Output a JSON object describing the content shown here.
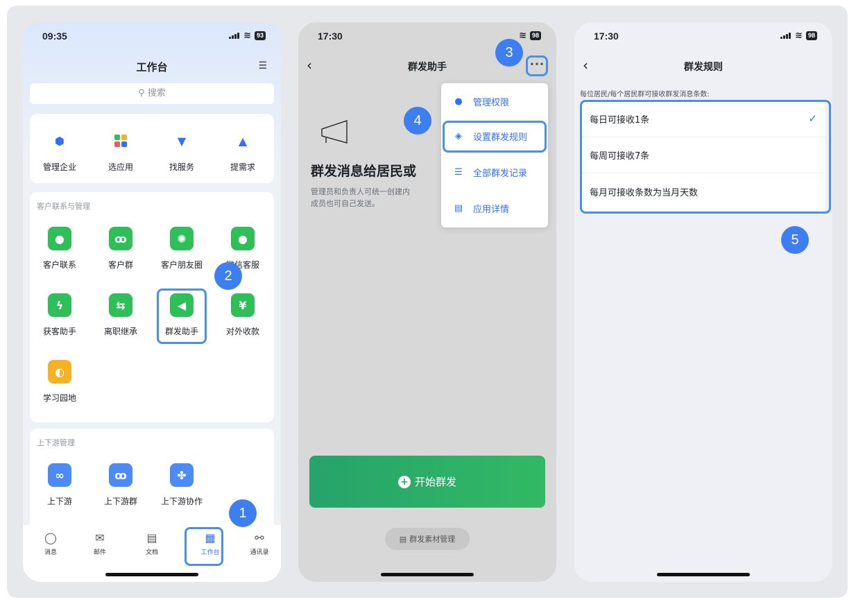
{
  "phone1": {
    "status": {
      "time": "09:35",
      "battery": "93"
    },
    "title": "工作台",
    "search_placeholder": "搜索",
    "top_tools": [
      {
        "label": "管理企业",
        "icon": "hexagon-icon"
      },
      {
        "label": "选应用",
        "icon": "apps-grid-icon"
      },
      {
        "label": "找服务",
        "icon": "tie-icon"
      },
      {
        "label": "提需求",
        "icon": "shapes-plus-icon"
      }
    ],
    "section_customer": {
      "title": "客户联系与管理",
      "items": [
        {
          "label": "客户联系",
          "icon": "chat-bubble-icon"
        },
        {
          "label": "客户群",
          "icon": "people-icon"
        },
        {
          "label": "客户朋友圈",
          "icon": "aperture-icon"
        },
        {
          "label": "微信客服",
          "icon": "message-icon"
        },
        {
          "label": "获客助手",
          "icon": "lightning-icon"
        },
        {
          "label": "离职继承",
          "icon": "transfer-icon"
        },
        {
          "label": "群发助手",
          "icon": "megaphone-icon"
        },
        {
          "label": "对外收款",
          "icon": "yuan-icon"
        },
        {
          "label": "学习园地",
          "icon": "planet-icon"
        }
      ]
    },
    "section_updown": {
      "title": "上下游管理",
      "items": [
        {
          "label": "上下游",
          "icon": "link-icon"
        },
        {
          "label": "上下游群",
          "icon": "people-icon"
        },
        {
          "label": "上下游协作",
          "icon": "clover-icon"
        }
      ]
    },
    "tabbar": [
      {
        "label": "消息",
        "icon": "chat-icon"
      },
      {
        "label": "邮件",
        "icon": "mail-icon"
      },
      {
        "label": "文档",
        "icon": "document-icon"
      },
      {
        "label": "工作台",
        "icon": "workbench-icon",
        "active": true
      },
      {
        "label": "通讯录",
        "icon": "org-chart-icon"
      }
    ]
  },
  "phone2": {
    "status": {
      "time": "17:30",
      "battery": "98"
    },
    "title": "群发助手",
    "heading": "群发消息给居民或",
    "description": "管理员和负责人可统一创建内\n成员也可自己发送。",
    "menu": [
      {
        "label": "管理权限",
        "icon": "admin-icon"
      },
      {
        "label": "设置群发规则",
        "icon": "layers-icon"
      },
      {
        "label": "全部群发记录",
        "icon": "records-icon"
      },
      {
        "label": "应用详情",
        "icon": "details-icon"
      }
    ],
    "start_button": "开始群发",
    "assets_button": "群发素材管理"
  },
  "phone3": {
    "status": {
      "time": "17:30",
      "battery": "98"
    },
    "title": "群发规则",
    "hint": "每位居民/每个居民群可接收群发消息条数:",
    "options": [
      {
        "label": "每日可接收1条",
        "selected": true
      },
      {
        "label": "每周可接收7条",
        "selected": false
      },
      {
        "label": "每月可接收条数为当月天数",
        "selected": false
      }
    ]
  },
  "steps": [
    "1",
    "2",
    "3",
    "4",
    "5"
  ],
  "colors": {
    "accent": "#3370ff",
    "highlight": "#4a90e8",
    "badge": "#3d7ef0",
    "green": "#2fbf59",
    "start_button": "#2aa869"
  }
}
